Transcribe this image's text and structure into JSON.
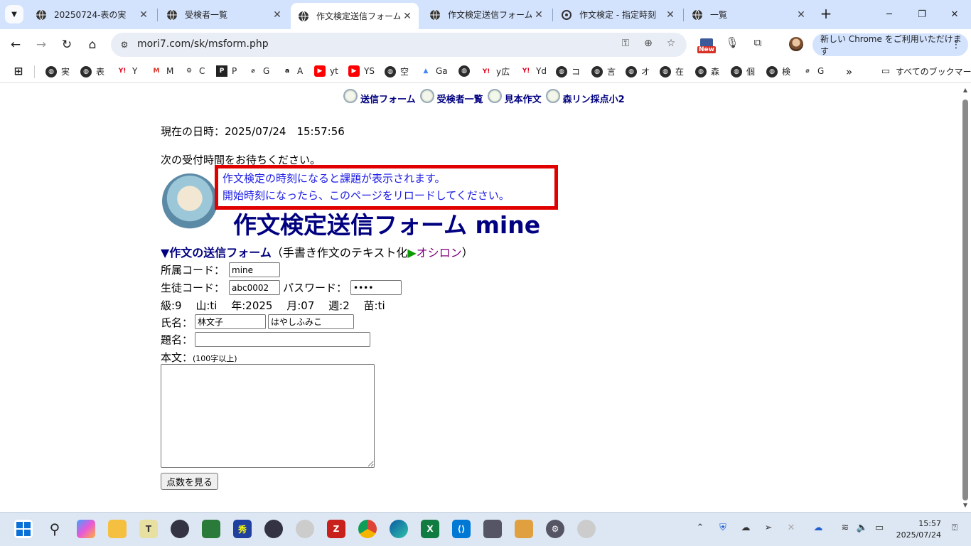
{
  "browser": {
    "tabs": [
      {
        "title": "20250724-表の実",
        "active": false
      },
      {
        "title": "受検者一覧",
        "active": false
      },
      {
        "title": "作文検定送信フォーム",
        "active": true
      },
      {
        "title": "作文検定送信フォーム",
        "active": false
      },
      {
        "title": "作文検定 - 指定時刻",
        "active": false
      },
      {
        "title": "一覧",
        "active": false
      }
    ],
    "url": "mori7.com/sk/msform.php",
    "update_button": "新しい Chrome をご利用いただけます",
    "new_badge": "New",
    "bookmarks": [
      "実",
      "表",
      "Y",
      "M",
      "C",
      "P",
      "G",
      "A",
      "yt",
      "YS",
      "空",
      "Ga",
      "",
      "y広",
      "Yd",
      "コ",
      "言",
      "オ",
      "在",
      "森",
      "個",
      "検",
      "G"
    ],
    "all_bookmarks": "すべてのブックマーク"
  },
  "page": {
    "nav": [
      "送信フォーム",
      "受検者一覧",
      "見本作文",
      "森リン採点小2"
    ],
    "datetime": "現在の日時：2025/07/24　15:57:56",
    "wait_message": "次の受付時間をお待ちください。",
    "notice_line1": "作文検定の時刻になると課題が表示されます。",
    "notice_line2": "開始時刻になったら、このページをリロードしてください。",
    "title": "作文検定送信フォーム mine",
    "form_heading": "▼作文の送信フォーム",
    "form_heading_paren_open": "（手書き作文のテキスト化",
    "form_heading_arrow": "▶",
    "form_heading_link": "オシロン",
    "form_heading_paren_close": "）",
    "affiliation_label": "所属コード：",
    "affiliation_value": "mine",
    "student_label": "生徒コード：",
    "student_value": "abc0002",
    "password_label": "パスワード：",
    "password_value": "abcd",
    "info_row": "級:9　 山:ti　 年:2025　 月:07　 週:2　 苗:ti",
    "name_label": "氏名：",
    "name_kanji": "林文子",
    "name_kana": "はやしふみこ",
    "subject_label": "題名：",
    "subject_value": "",
    "body_label": "本文：",
    "body_hint": "(100字以上)",
    "body_value": "",
    "submit_label": "点数を見る"
  },
  "taskbar": {
    "time": "15:57",
    "date": "2025/07/24"
  },
  "colors": {
    "nav_text": "#000080",
    "notice_border": "#e00000",
    "notice_text": "#1a1ae6",
    "link_purple": "#800080",
    "tab_strip": "#d3e3fd"
  }
}
